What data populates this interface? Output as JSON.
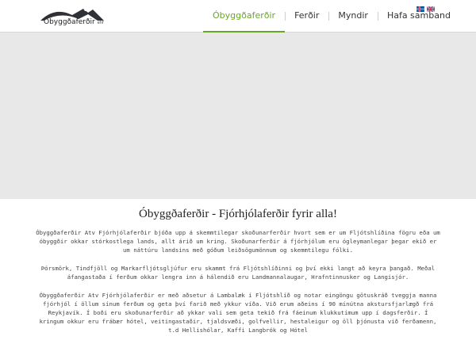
{
  "logo": {
    "name": "Óbyggðaferðir",
    "suffix": "ehf"
  },
  "nav": {
    "items": [
      {
        "label": "Óbyggðaferðir",
        "active": true
      },
      {
        "label": "Ferðir",
        "active": false
      },
      {
        "label": "Myndir",
        "active": false
      },
      {
        "label": "Hafa samband",
        "active": false
      }
    ]
  },
  "languages": [
    "icelandic-flag",
    "british-flag"
  ],
  "colors": {
    "accent": "#6aa628",
    "hero_background": "#e8e8e8"
  },
  "main": {
    "title": "Óbyggðaferðir - Fjórhjólaferðir fyrir alla!",
    "paragraphs": [
      "Óbyggðaferðir Atv Fjórhjólaferðir bjóða upp á skemmtilegar skoðunarferðir hvort sem er um Fljótshlíðina fögru eða um óbyggðir okkar stórkostlega lands, allt árið um kring. Skoðunarferðir á fjórhjólum eru ógleymanlegar þegar ekið er um náttúru landsins með góðum leiðsögumönnum og skemmtilegu fólki.",
      "Þórsmörk, Tindfjöll og Markarfljótsgljúfur eru skammt frá Fljótshlíðinni og því ekki langt að keyra þangað. Meðal áfangastaða í ferðum okkar lengra inn á hálendið eru Landmannalaugar, Hrafntinnusker og Langisjór.",
      "Óbyggðaferðir Atv Fjórhjólaferðir er með aðsetur á Lambalæk í Fljótshlíð og notar eingöngu götuskráð tveggja manna fjórhjól í öllum sínum ferðum og geta því farið með ykkur víða. Við erum aðeins í 90 mínútna akstursfjarlægð frá Reykjavík. Í boði eru skoðunarferðir að ykkar vali sem geta tekið frá fáeinum klukkutímum upp í dagsferðir. Í kringum okkur eru frábær hótel, veitingastaðir, tjaldsvæði, golfvellir, hestaleigur og öll þjónusta við ferðamenn, t.d Hellishólar, Kaffi Langbrók og Hótel"
    ]
  }
}
